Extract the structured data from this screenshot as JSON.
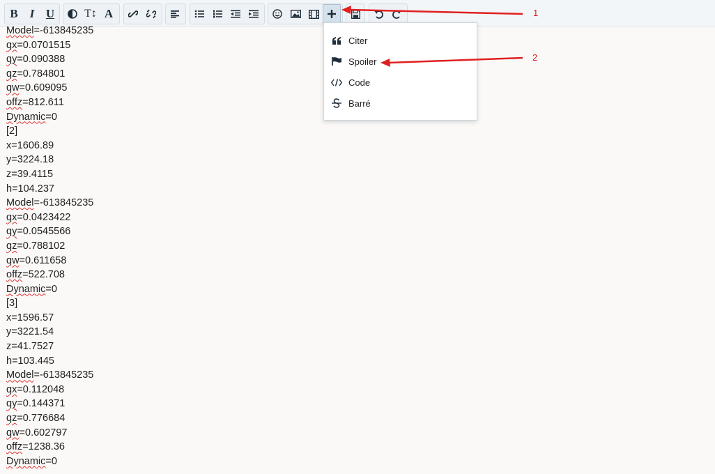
{
  "toolbar": {
    "bold": "B",
    "italic": "I",
    "underline": "U",
    "text_size": "T↕",
    "font": "A",
    "icons": [
      "bold-icon",
      "italic-icon",
      "underline-icon",
      "color-icon",
      "text-size-icon",
      "font-icon",
      "link-icon",
      "unlink-icon",
      "align-icon",
      "bullet-list-icon",
      "numbered-list-icon",
      "outdent-icon",
      "indent-icon",
      "smiley-icon",
      "image-icon",
      "media-icon",
      "plus-icon",
      "save-icon",
      "undo-icon",
      "redo-icon"
    ]
  },
  "menu": {
    "items": [
      {
        "label": "Citer",
        "icon": "quote-icon"
      },
      {
        "label": "Spoiler",
        "icon": "flag-icon"
      },
      {
        "label": "Code",
        "icon": "code-icon"
      },
      {
        "label": "Barré",
        "icon": "strikethrough-icon"
      }
    ]
  },
  "editor": {
    "lines": [
      [
        "Model",
        "=-613845235"
      ],
      [
        "qx",
        "=0.0701515"
      ],
      [
        "qy",
        "=0.090388"
      ],
      [
        "qz",
        "=0.784801"
      ],
      [
        "qw",
        "=0.609095"
      ],
      [
        "offz",
        "=812.611"
      ],
      [
        "Dynamic",
        "=0"
      ],
      [
        "",
        "[2]"
      ],
      [
        "",
        "x=1606.89"
      ],
      [
        "",
        "y=3224.18"
      ],
      [
        "",
        "z=39.4115"
      ],
      [
        "",
        "h=104.237"
      ],
      [
        "Model",
        "=-613845235"
      ],
      [
        "qx",
        "=0.0423422"
      ],
      [
        "qy",
        "=0.0545566"
      ],
      [
        "qz",
        "=0.788102"
      ],
      [
        "qw",
        "=0.611658"
      ],
      [
        "offz",
        "=522.708"
      ],
      [
        "Dynamic",
        "=0"
      ],
      [
        "",
        "[3]"
      ],
      [
        "",
        "x=1596.57"
      ],
      [
        "",
        "y=3221.54"
      ],
      [
        "",
        "z=41.7527"
      ],
      [
        "",
        "h=103.445"
      ],
      [
        "Model",
        "=-613845235"
      ],
      [
        "qx",
        "=0.112048"
      ],
      [
        "qy",
        "=0.144371"
      ],
      [
        "qz",
        "=0.776684"
      ],
      [
        "qw",
        "=0.602797"
      ],
      [
        "offz",
        "=1238.36"
      ],
      [
        "Dynamic",
        "=0"
      ]
    ]
  },
  "annotations": {
    "label1": "1",
    "label2": "2",
    "color": "#e02020"
  }
}
